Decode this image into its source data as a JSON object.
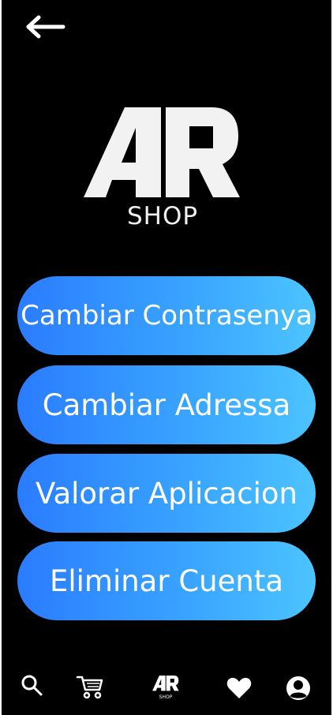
{
  "header": {
    "back_icon": "arrow-left-icon"
  },
  "logo": {
    "mark": "AR",
    "sub": "SHOP"
  },
  "menu": {
    "items": [
      {
        "label": "Cambiar Contrasenya"
      },
      {
        "label": "Cambiar Adressa"
      },
      {
        "label": "Valorar Aplicacion"
      },
      {
        "label": "Eliminar Cuenta"
      }
    ]
  },
  "bottom_nav": {
    "items": [
      {
        "icon": "search-icon"
      },
      {
        "icon": "cart-icon"
      },
      {
        "icon": "ar-shop-logo-icon",
        "label": "SHOP"
      },
      {
        "icon": "heart-icon"
      },
      {
        "icon": "user-icon"
      }
    ]
  },
  "colors": {
    "background": "#000000",
    "button_gradient_start": "#2a7cff",
    "button_gradient_end": "#4cc4ff",
    "text": "#ffffff"
  }
}
